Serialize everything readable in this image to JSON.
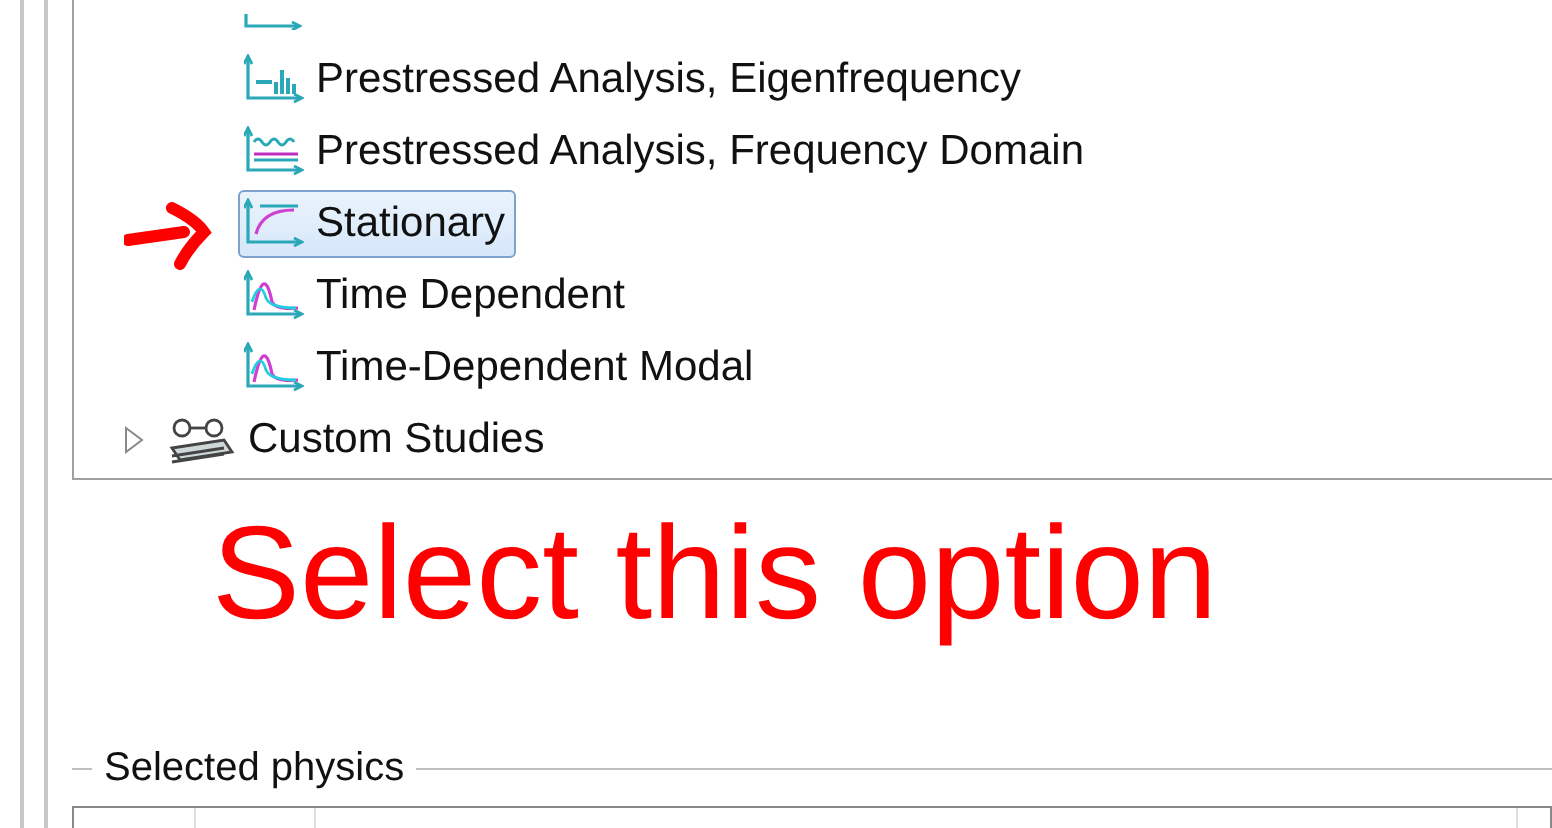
{
  "tree": {
    "items": [
      {
        "label": "Prestressed Analysis, Eigenfrequency",
        "kind": "bars",
        "selected": false
      },
      {
        "label": "Prestressed Analysis, Frequency Domain",
        "kind": "wave",
        "selected": false
      },
      {
        "label": "Stationary",
        "kind": "stationary",
        "selected": true
      },
      {
        "label": "Time Dependent",
        "kind": "peak",
        "selected": false
      },
      {
        "label": "Time-Dependent Modal",
        "kind": "peak",
        "selected": false
      }
    ],
    "group": {
      "label": "Custom Studies",
      "expanded": false
    }
  },
  "annotation": {
    "text": "Select this option"
  },
  "selected_physics": {
    "title": "Selected physics"
  }
}
